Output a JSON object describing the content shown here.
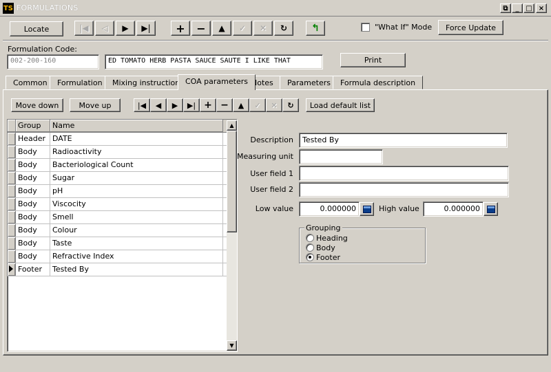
{
  "window": {
    "title": "FORMULATIONS",
    "logo": "TS"
  },
  "toolbar": {
    "locate_label": "Locate",
    "what_if_label": "\"What If\" Mode",
    "force_update_label": "Force Update"
  },
  "header": {
    "code_label": "Formulation Code:",
    "code_value": "002-200-160",
    "name_value": "ED TOMATO HERB PASTA SAUCE SAUTE I LIKE THAT",
    "print_label": "Print"
  },
  "tabs": [
    "Common",
    "Formulation",
    "Mixing instructions",
    "COA parameters",
    "Notes",
    "Parameters",
    "Formula description"
  ],
  "coa_toolbar": {
    "move_down_label": "Move down",
    "move_up_label": "Move up",
    "load_default_label": "Load default list"
  },
  "grid": {
    "columns": [
      "Group",
      "Name"
    ],
    "rows": [
      {
        "group": "Header",
        "name": "DATE"
      },
      {
        "group": "Body",
        "name": "Radioactivity"
      },
      {
        "group": "Body",
        "name": "Bacteriological Count"
      },
      {
        "group": "Body",
        "name": "Sugar"
      },
      {
        "group": "Body",
        "name": "pH"
      },
      {
        "group": "Body",
        "name": "Viscocity"
      },
      {
        "group": "Body",
        "name": "Smell"
      },
      {
        "group": "Body",
        "name": "Colour"
      },
      {
        "group": "Body",
        "name": "Taste"
      },
      {
        "group": "Body",
        "name": "Refractive Index"
      },
      {
        "group": "Footer",
        "name": "Tested By"
      }
    ]
  },
  "detail": {
    "description_label": "Description",
    "description_value": "Tested By",
    "measuring_unit_label": "Measuring unit",
    "measuring_unit_value": "",
    "user_field1_label": "User field 1",
    "user_field1_value": "",
    "user_field2_label": "User field 2",
    "user_field2_value": "",
    "low_value_label": "Low value",
    "low_value": "0.000000",
    "high_value_label": "High value",
    "high_value": "0.000000",
    "grouping_label": "Grouping",
    "grouping_options": [
      "Heading",
      "Body",
      "Footer"
    ],
    "grouping_selected": "Footer"
  }
}
